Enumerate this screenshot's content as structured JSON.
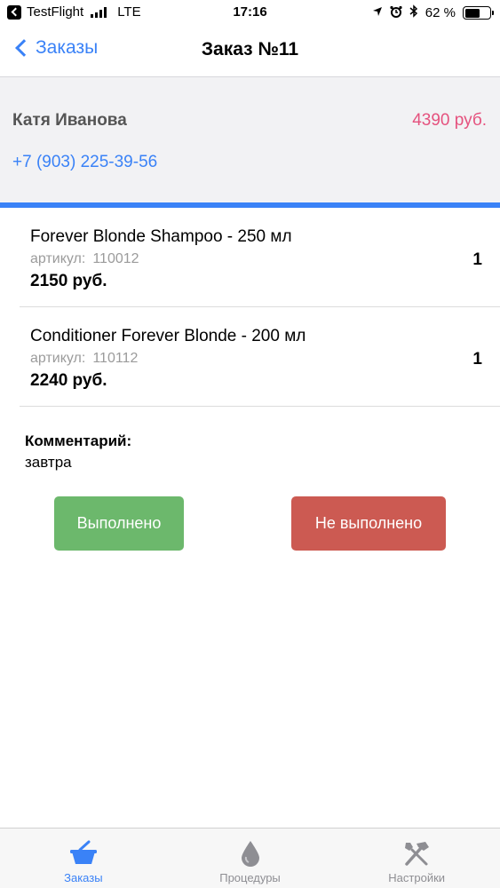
{
  "status_bar": {
    "carrier": "TestFlight",
    "network": "LTE",
    "time": "17:16",
    "battery_percent": "62 %",
    "battery_level": 0.62
  },
  "nav": {
    "back_label": "Заказы",
    "title": "Заказ №11"
  },
  "customer": {
    "name": "Катя Иванова",
    "total": "4390 руб.",
    "phone": "+7 (903) 225-39-56"
  },
  "items": [
    {
      "name": "Forever Blonde Shampoo - 250 мл",
      "sku_label": "артикул:",
      "sku": "110012",
      "price": "2150 руб.",
      "qty": "1"
    },
    {
      "name": "Conditioner Forever Blonde - 200 мл",
      "sku_label": "артикул:",
      "sku": "110112",
      "price": "2240 руб.",
      "qty": "1"
    }
  ],
  "comment": {
    "label": "Комментарий:",
    "text": "завтра"
  },
  "actions": {
    "done_label": "Выполнено",
    "not_done_label": "Не выполнено"
  },
  "tabs": [
    {
      "label": "Заказы",
      "icon": "basket-icon",
      "active": true
    },
    {
      "label": "Процедуры",
      "icon": "drop-icon",
      "active": false
    },
    {
      "label": "Настройки",
      "icon": "tools-icon",
      "active": false
    }
  ],
  "colors": {
    "accent": "#3a82f7",
    "total": "#e5527e",
    "done": "#6cb86c",
    "not_done": "#cc5a52"
  }
}
